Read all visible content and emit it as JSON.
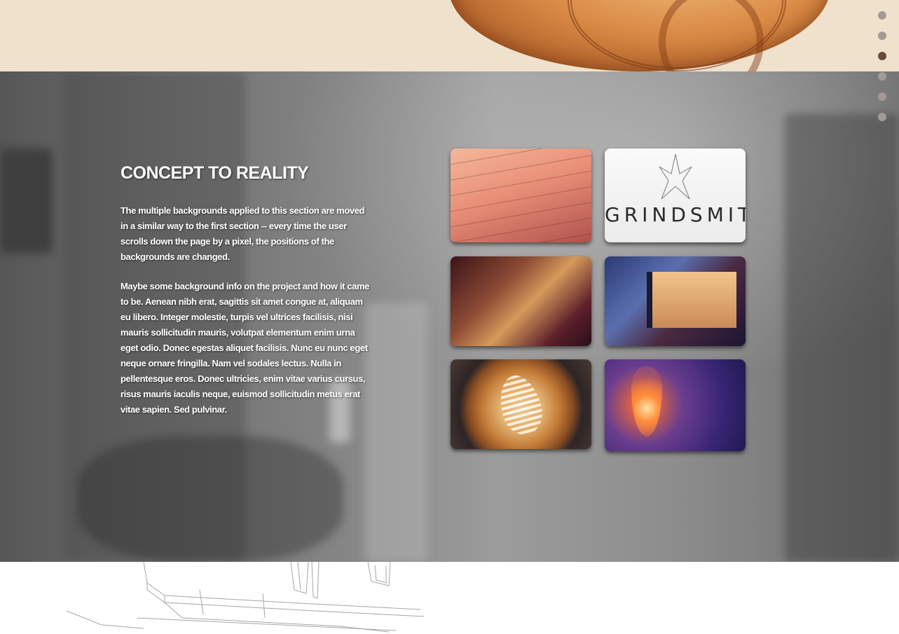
{
  "concept": {
    "title": "CONCEPT TO REALITY",
    "paragraphs": [
      "The multiple backgrounds applied to this section are moved in a similar way to the first section -- every time the user scrolls down the page by a pixel, the positions of the backgrounds are changed.",
      "Maybe some background info on the project and how it came to be. Aenean nibh erat, sagittis sit amet congue at, aliquam eu libero. Integer molestie, turpis vel ultrices facilisis, nisi mauris sollicitudin mauris, volutpat elementum enim urna eget odio. Donec egestas aliquet facilisis. Nunc eu nunc eget neque ornare fringilla. Nam vel sodales lectus. Nulla in pellentesque eros. Donec ultricies, enim vitae varius cursus, risus mauris iaculis neque, euismod sollicitudin metus erat vitae sapien. Sed pulvinar."
    ]
  },
  "gallery": {
    "signage_text": "GRINDSMITH"
  },
  "dot_nav": {
    "count": 6,
    "active_index": 2
  },
  "colors": {
    "top_band": "#f0e1cc",
    "dot": "#a39a95",
    "dot_active": "#6b4a3c"
  }
}
